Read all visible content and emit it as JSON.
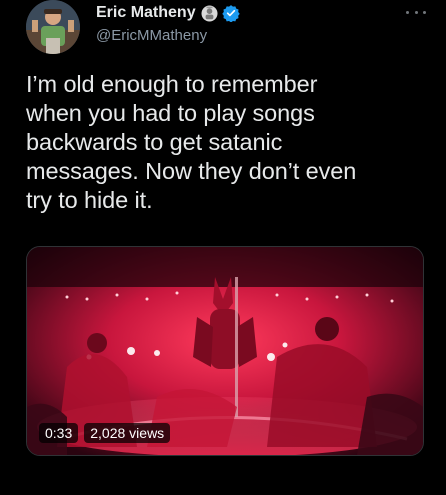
{
  "author": {
    "display_name": "Eric Matheny",
    "handle": "@EricMMatheny",
    "affiliate_badge_icon": "affiliate-badge-icon",
    "verified_icon": "verified-badge-icon",
    "verified_color": "#1d9bf0"
  },
  "menu": {
    "icon": "more-icon"
  },
  "tweet": {
    "text": "I’m old enough to remember\nwhen you had to play songs\nbackwards to get satanic\nmessages. Now they don’t even\ntry to hide it."
  },
  "media": {
    "type": "video",
    "duration": "0:33",
    "views": "2,028 views"
  },
  "colors": {
    "background": "#000000",
    "primary_text": "#e7e9ea",
    "secondary_text": "#8b98a5"
  }
}
